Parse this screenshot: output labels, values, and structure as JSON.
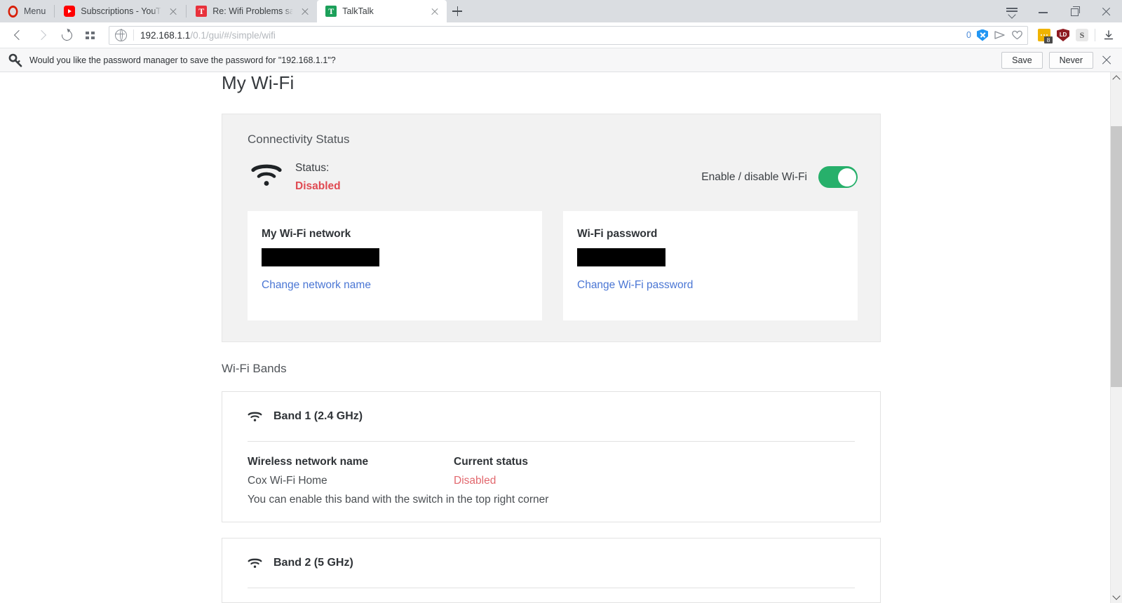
{
  "browser": {
    "menu_label": "Menu",
    "tabs": [
      {
        "title": "Subscriptions - YouTube",
        "favicon": "youtube-icon",
        "active": false
      },
      {
        "title": "Re: Wifi Problems sagemc",
        "favicon": "thunderbird-icon",
        "active": false
      },
      {
        "title": "TalkTalk",
        "favicon": "talktalk-icon",
        "active": true
      }
    ],
    "new_tab_label": "+",
    "window_controls": [
      "list-chevron-icon",
      "minimize-icon",
      "restore-icon",
      "close-icon"
    ],
    "nav": {
      "back": "back-arrow-icon",
      "forward": "forward-arrow-icon",
      "reload": "reload-icon",
      "speeddial": "grid-icon"
    },
    "address": {
      "security_icon": "globe-icon",
      "host": "192.168.1.1",
      "path": "/0.1/gui/#/simple/wifi",
      "full_url": "192.168.1.1/0.1/gui/#/simple/wifi",
      "blocked_count": "0",
      "adblock_icon": "shield-x-icon",
      "share_icon": "send-icon",
      "heart_icon": "heart-icon"
    },
    "extensions": [
      {
        "name": "adblock-extension-icon",
        "badge": "8",
        "color": "#f0b400"
      },
      {
        "name": "lastpass-extension-icon",
        "label": "LD",
        "color": "#8e1b22"
      },
      {
        "name": "s-extension-icon",
        "label": "S",
        "color": "#e8e8e8"
      }
    ],
    "downloads_icon": "download-icon"
  },
  "notification": {
    "icon": "key-icon",
    "message": "Would you like the password manager to save the password for \"192.168.1.1\"?",
    "save_label": "Save",
    "never_label": "Never",
    "close_icon": "close-icon"
  },
  "page": {
    "title": "My Wi-Fi",
    "connectivity": {
      "heading": "Connectivity Status",
      "wifi_icon": "wifi-icon",
      "status_label": "Status:",
      "status_value": "Disabled",
      "status_color": "#e04a52",
      "toggle_label": "Enable / disable Wi-Fi",
      "toggle_on": true,
      "toggle_color": "#27b06b",
      "cards": [
        {
          "title": "My Wi-Fi network",
          "value_redacted": true,
          "link": "Change network name",
          "link_color": "#4a76d4"
        },
        {
          "title": "Wi-Fi password",
          "value_redacted": true,
          "link": "Change Wi-Fi password",
          "link_color": "#4a76d4"
        }
      ]
    },
    "bands_section_title": "Wi-Fi Bands",
    "bands": [
      {
        "icon": "wifi-icon",
        "name": "Band 1 (2.4 GHz)",
        "col_network_name": "Wireless network name",
        "col_current_status": "Current status",
        "network_name": "Cox Wi-Fi Home",
        "current_status": "Disabled",
        "status_color": "#e2686e",
        "note": "You can enable this band with the switch in the top right corner"
      },
      {
        "icon": "wifi-icon",
        "name": "Band 2 (5 GHz)",
        "col_network_name": "",
        "col_current_status": "",
        "network_name": "",
        "current_status": "",
        "note": ""
      }
    ]
  },
  "scrollbar": {
    "up_icon": "chevron-up-icon",
    "down_icon": "chevron-down-icon"
  }
}
